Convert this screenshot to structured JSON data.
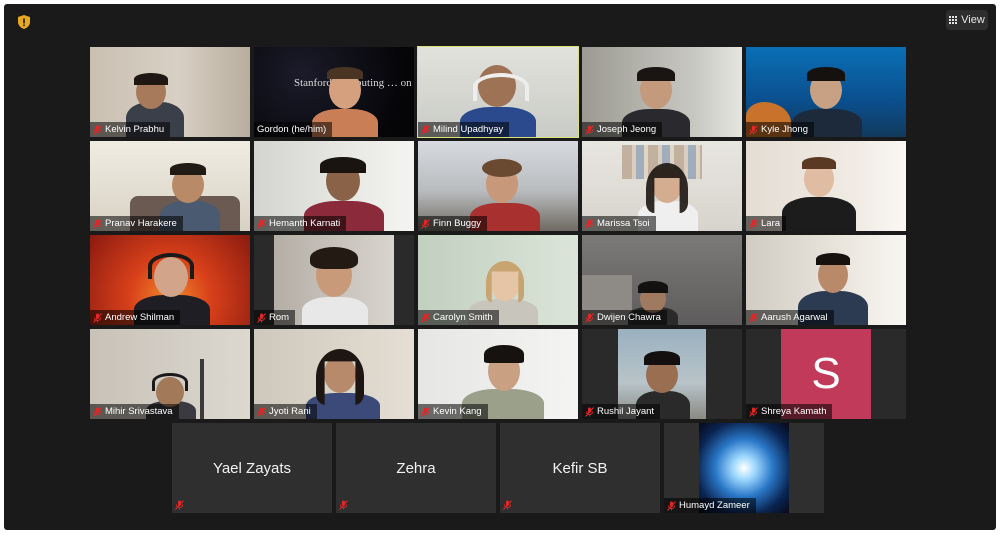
{
  "toolbar": {
    "view_label": "View"
  },
  "participants": [
    {
      "name": "Kelvin Prabhu"
    },
    {
      "name": "Gordon (he/him)",
      "bg_text": "Stanford Computing … on"
    },
    {
      "name": "Milind Upadhyay"
    },
    {
      "name": "Joseph Jeong"
    },
    {
      "name": "Kyle Jhong"
    },
    {
      "name": "Pranav Harakere"
    },
    {
      "name": "Hemanth Karnati"
    },
    {
      "name": "Finn Buggy"
    },
    {
      "name": "Marissa Tsoi"
    },
    {
      "name": "Lara"
    },
    {
      "name": "Andrew Shilman"
    },
    {
      "name": "Rom"
    },
    {
      "name": "Carolyn Smith"
    },
    {
      "name": "Dwijen Chawra"
    },
    {
      "name": "Aarush Agarwal"
    },
    {
      "name": "Mihir Srivastava"
    },
    {
      "name": "Jyoti Rani"
    },
    {
      "name": "Kevin Kang"
    },
    {
      "name": "Rushil Jayant"
    },
    {
      "name": "Shreya Kamath",
      "avatar_letter": "S"
    },
    {
      "name": "Yael Zayats"
    },
    {
      "name": "Zehra"
    },
    {
      "name": "Kefir SB"
    },
    {
      "name": "Humayd Zameer"
    }
  ],
  "colors": {
    "active_speaker": "#d9e27a",
    "muted_red": "#e02828",
    "avatar_pink": "#c13a5a"
  }
}
